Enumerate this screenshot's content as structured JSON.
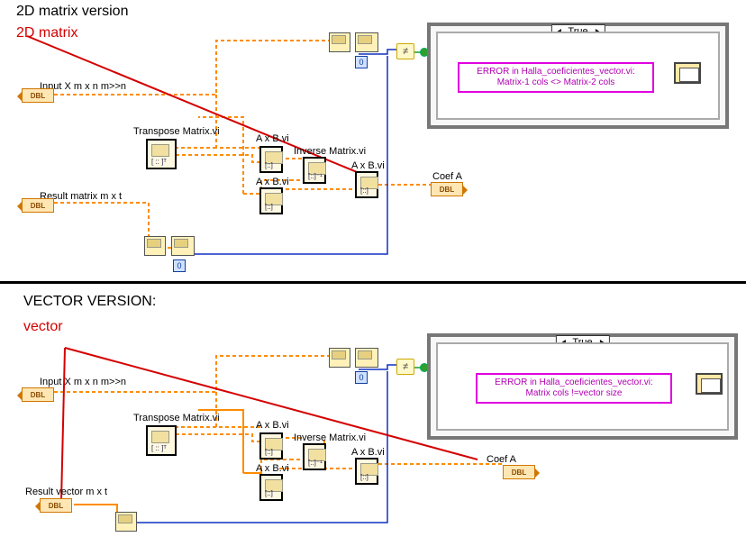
{
  "top": {
    "title": "2D matrix version",
    "red_label": "2D matrix",
    "input_label": "Input X  m x n  m>>n",
    "input_terminal": "DBL",
    "result_label": "Result matrix  m x t",
    "result_terminal": "DBL",
    "transpose_label": "Transpose Matrix.vi",
    "axb1_label": "A x B.vi",
    "axb2_label": "A x B.vi",
    "axb3_label": "A x B.vi",
    "inverse_label": "Inverse Matrix.vi",
    "coef_label": "Coef A",
    "coef_terminal": "DBL",
    "zero1": "0",
    "zero2": "0",
    "case_selector": "True",
    "err_line1": "ERROR in Halla_coeficientes_vector.vi:",
    "err_line2": "Matrix-1 cols <> Matrix-2 cols"
  },
  "bottom": {
    "title": "VECTOR VERSION:",
    "red_label": "vector",
    "input_label": "Input X  m x n  m>>n",
    "input_terminal": "DBL",
    "result_label": "Result vector  m x t",
    "result_terminal": "DBL",
    "transpose_label": "Transpose Matrix.vi",
    "axb1_label": "A x B.vi",
    "axb2_label": "A x B.vi",
    "axb3_label": "A x B.vi",
    "inverse_label": "Inverse Matrix.vi",
    "coef_label": "Coef A",
    "coef_terminal": "DBL",
    "zero1": "0",
    "case_selector": "True",
    "err_line1": "ERROR in Halla_coeficientes_vector.vi:",
    "err_line2": "Matrix cols !=vector size"
  }
}
